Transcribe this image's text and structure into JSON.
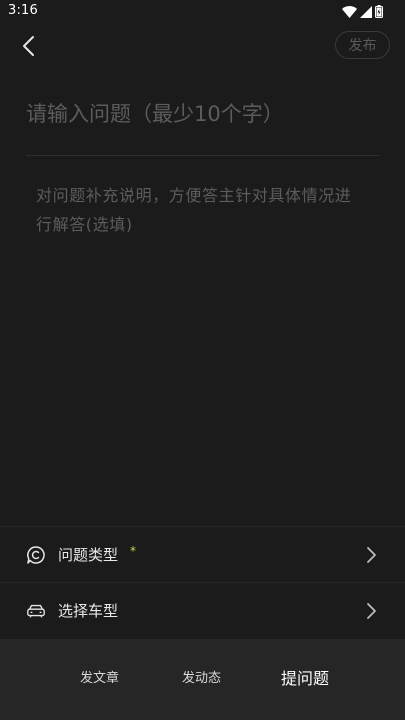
{
  "status_bar": {
    "time": "3:16"
  },
  "nav": {
    "publish_label": "发布"
  },
  "form": {
    "title_placeholder": "请输入问题（最少10个字）",
    "description_placeholder": "对问题补充说明，方便答主针对具体情况进行解答(选填)"
  },
  "options": [
    {
      "label": "问题类型",
      "required_mark": "*",
      "icon": "chat-bubble-icon"
    },
    {
      "label": "选择车型",
      "icon": "car-icon"
    }
  ],
  "tabs": [
    {
      "label": "发文章",
      "active": false
    },
    {
      "label": "发动态",
      "active": false
    },
    {
      "label": "提问题",
      "active": true
    }
  ],
  "colors": {
    "background": "#1b1b1b",
    "bottom_bar": "#262626",
    "required_star": "#c9d64a",
    "placeholder": "#5c5c5c"
  }
}
